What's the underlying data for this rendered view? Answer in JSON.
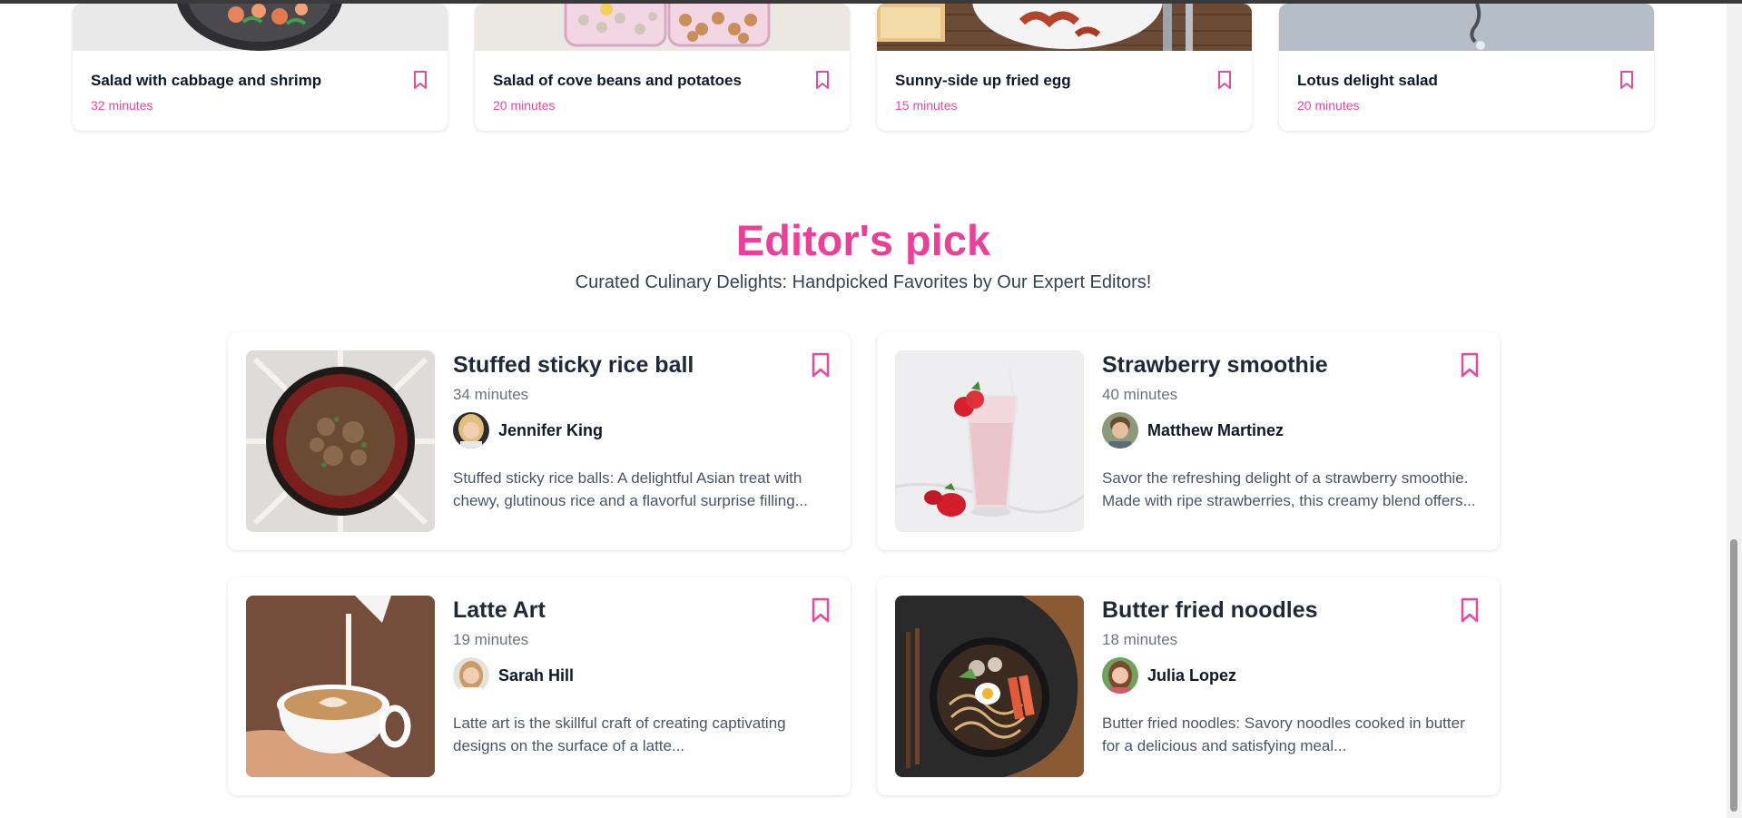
{
  "colors": {
    "accent": "#ec4899",
    "heading": "#ec3f98"
  },
  "top_recipes": [
    {
      "title": "Salad with cabbage and shrimp",
      "time": "32 minutes",
      "icon": "bookmark-icon"
    },
    {
      "title": "Salad of cove beans and potatoes",
      "time": "20 minutes",
      "icon": "bookmark-icon"
    },
    {
      "title": "Sunny-side up fried egg",
      "time": "15 minutes",
      "icon": "bookmark-icon"
    },
    {
      "title": "Lotus delight salad",
      "time": "20 minutes",
      "icon": "bookmark-icon"
    }
  ],
  "editors_pick": {
    "title": "Editor's pick",
    "subtitle": "Curated Culinary Delights: Handpicked Favorites by Our Expert Editors!",
    "items": [
      {
        "title": "Stuffed sticky rice ball",
        "time": "34 minutes",
        "author": "Jennifer King",
        "description": "Stuffed sticky rice balls: A delightful Asian treat with chewy, glutinous rice and a flavorful surprise filling..."
      },
      {
        "title": "Strawberry smoothie",
        "time": "40 minutes",
        "author": "Matthew Martinez",
        "description": "Savor the refreshing delight of a strawberry smoothie. Made with ripe strawberries, this creamy blend offers..."
      },
      {
        "title": "Latte Art",
        "time": "19 minutes",
        "author": "Sarah Hill",
        "description": "Latte art is the skillful craft of creating captivating designs on the surface of a latte..."
      },
      {
        "title": "Butter fried noodles",
        "time": "18 minutes",
        "author": "Julia Lopez",
        "description": "Butter fried noodles: Savory noodles cooked in butter for a delicious and satisfying meal..."
      }
    ]
  }
}
